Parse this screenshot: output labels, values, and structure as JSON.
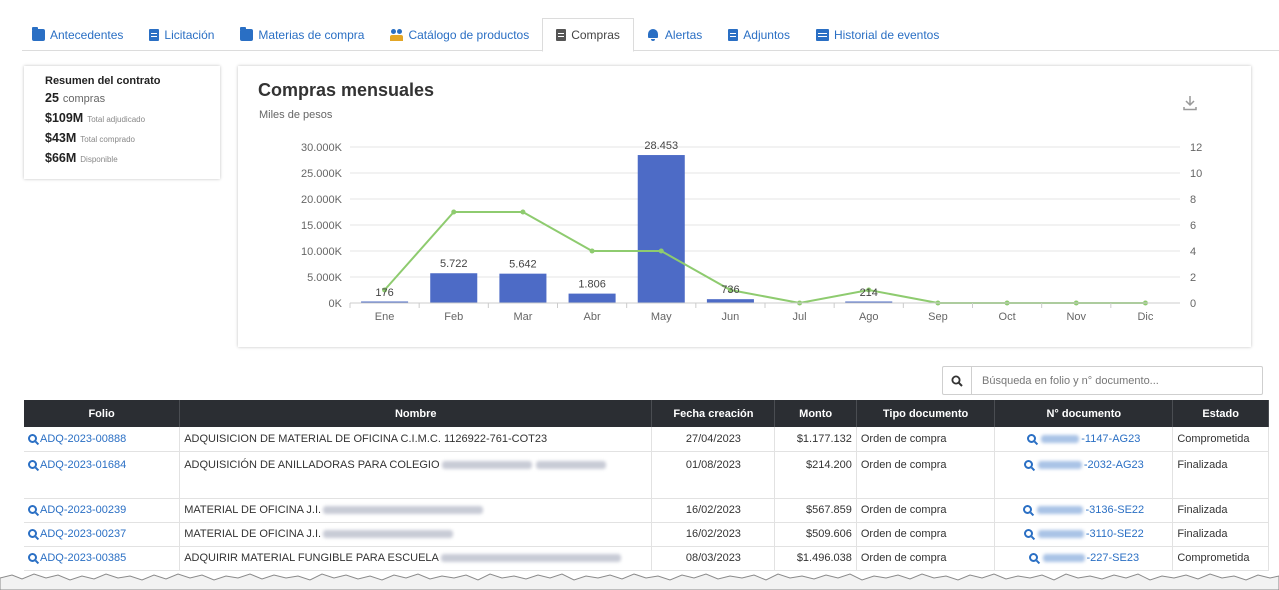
{
  "tabs": [
    {
      "label": "Antecedentes",
      "icon": "folder-icon"
    },
    {
      "label": "Licitación",
      "icon": "document-icon"
    },
    {
      "label": "Materias de compra",
      "icon": "folder-icon"
    },
    {
      "label": "Catálogo de productos",
      "icon": "users-icon"
    },
    {
      "label": "Compras",
      "icon": "document-icon",
      "active": true
    },
    {
      "label": "Alertas",
      "icon": "bell-icon"
    },
    {
      "label": "Adjuntos",
      "icon": "document-icon"
    },
    {
      "label": "Historial de eventos",
      "icon": "calendar-icon"
    }
  ],
  "summary": {
    "title": "Resumen del contrato",
    "compras_value": "25",
    "compras_label": "compras",
    "adjudicado_value": "$109M",
    "adjudicado_label": "Total adjudicado",
    "comprado_value": "$43M",
    "comprado_label": "Total comprado",
    "disponible_value": "$66M",
    "disponible_label": "Disponible"
  },
  "chart": {
    "title": "Compras mensuales",
    "subtitle": "Miles de pesos"
  },
  "chart_data": {
    "type": "bar",
    "categories": [
      "Ene",
      "Feb",
      "Mar",
      "Abr",
      "May",
      "Jun",
      "Jul",
      "Ago",
      "Sep",
      "Oct",
      "Nov",
      "Dic"
    ],
    "series": [
      {
        "type": "bar",
        "values": [
          176,
          5722,
          5642,
          1806,
          28453,
          736,
          0,
          214,
          0,
          0,
          0,
          0
        ],
        "labels": [
          "176",
          "5.722",
          "5.642",
          "1.806",
          "28.453",
          "736",
          "",
          "214",
          "",
          "",
          "",
          ""
        ],
        "color": "#4d6bc6"
      },
      {
        "type": "line",
        "axis": "right",
        "values": [
          1,
          7,
          7,
          4,
          4,
          1,
          0,
          1,
          0,
          0,
          0,
          0
        ],
        "color": "#8ecb6f"
      }
    ],
    "y_left_ticks": [
      "0K",
      "5.000K",
      "10.000K",
      "15.000K",
      "20.000K",
      "25.000K",
      "30.000K"
    ],
    "ylim_left": [
      0,
      30000
    ],
    "y_right_ticks": [
      "0",
      "2",
      "4",
      "6",
      "8",
      "10",
      "12"
    ],
    "ylim_right": [
      0,
      12
    ],
    "grid": true
  },
  "search": {
    "placeholder": "Búsqueda en folio y n° documento..."
  },
  "table": {
    "headers": [
      "Folio",
      "Nombre",
      "Fecha creación",
      "Monto",
      "Tipo documento",
      "N° documento",
      "Estado"
    ],
    "rows": [
      {
        "folio": "ADQ-2023-00888",
        "nombre": "ADQUISICION DE MATERIAL DE OFICINA C.I.M.C. 1126922-761-COT23",
        "fecha": "27/04/2023",
        "monto": "$1.177.132",
        "tipo": "Orden de compra",
        "ndoc": "-1147-AG23",
        "estado": "Comprometida"
      },
      {
        "folio": "ADQ-2023-01684",
        "nombre": "ADQUISICIÓN DE ANILLADORAS PARA COLEGIO",
        "fecha": "01/08/2023",
        "monto": "$214.200",
        "tipo": "Orden de compra",
        "ndoc": "-2032-AG23",
        "estado": "Finalizada"
      },
      {
        "folio": "ADQ-2023-00239",
        "nombre": "MATERIAL DE OFICINA J.I.",
        "fecha": "16/02/2023",
        "monto": "$567.859",
        "tipo": "Orden de compra",
        "ndoc": "-3136-SE22",
        "estado": "Finalizada"
      },
      {
        "folio": "ADQ-2023-00237",
        "nombre": "MATERIAL DE OFICINA J.I.",
        "fecha": "16/02/2023",
        "monto": "$509.606",
        "tipo": "Orden de compra",
        "ndoc": "-3110-SE22",
        "estado": "Finalizada"
      },
      {
        "folio": "ADQ-2023-00385",
        "nombre": "ADQUIRIR MATERIAL FUNGIBLE PARA ESCUELA",
        "fecha": "08/03/2023",
        "monto": "$1.496.038",
        "tipo": "Orden de compra",
        "ndoc": "-227-SE23",
        "estado": "Comprometida"
      }
    ]
  }
}
